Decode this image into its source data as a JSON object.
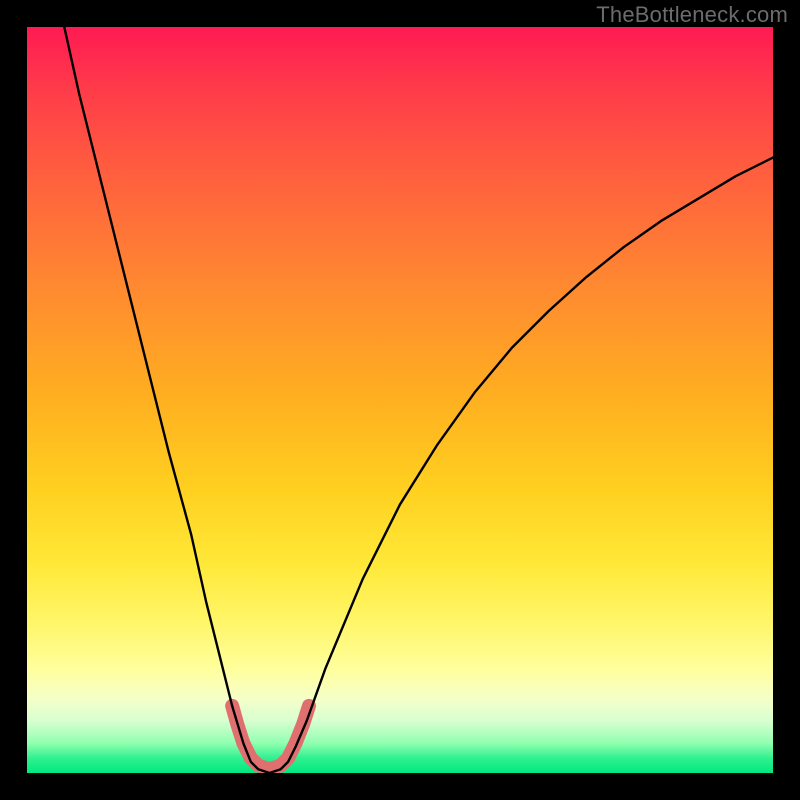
{
  "watermark": "TheBottleneck.com",
  "chart_data": {
    "type": "line",
    "title": "",
    "xlabel": "",
    "ylabel": "",
    "xlim": [
      0,
      100
    ],
    "ylim": [
      0,
      100
    ],
    "curve": [
      {
        "x": 5.0,
        "y": 100.0
      },
      {
        "x": 7.0,
        "y": 91.0
      },
      {
        "x": 10.0,
        "y": 79.0
      },
      {
        "x": 13.0,
        "y": 67.0
      },
      {
        "x": 16.0,
        "y": 55.0
      },
      {
        "x": 19.0,
        "y": 43.0
      },
      {
        "x": 22.0,
        "y": 32.0
      },
      {
        "x": 24.0,
        "y": 23.0
      },
      {
        "x": 26.0,
        "y": 15.0
      },
      {
        "x": 27.5,
        "y": 9.0
      },
      {
        "x": 29.0,
        "y": 4.0
      },
      {
        "x": 30.0,
        "y": 1.5
      },
      {
        "x": 31.0,
        "y": 0.5
      },
      {
        "x": 32.5,
        "y": 0.0
      },
      {
        "x": 34.0,
        "y": 0.5
      },
      {
        "x": 35.0,
        "y": 1.5
      },
      {
        "x": 36.0,
        "y": 3.5
      },
      {
        "x": 37.5,
        "y": 7.0
      },
      {
        "x": 40.0,
        "y": 14.0
      },
      {
        "x": 45.0,
        "y": 26.0
      },
      {
        "x": 50.0,
        "y": 36.0
      },
      {
        "x": 55.0,
        "y": 44.0
      },
      {
        "x": 60.0,
        "y": 51.0
      },
      {
        "x": 65.0,
        "y": 57.0
      },
      {
        "x": 70.0,
        "y": 62.0
      },
      {
        "x": 75.0,
        "y": 66.5
      },
      {
        "x": 80.0,
        "y": 70.5
      },
      {
        "x": 85.0,
        "y": 74.0
      },
      {
        "x": 90.0,
        "y": 77.0
      },
      {
        "x": 95.0,
        "y": 80.0
      },
      {
        "x": 100.0,
        "y": 82.5
      }
    ],
    "markers": [
      {
        "x": 27.5,
        "y": 9.0
      },
      {
        "x": 28.2,
        "y": 6.5
      },
      {
        "x": 29.0,
        "y": 4.0
      },
      {
        "x": 30.0,
        "y": 2.0
      },
      {
        "x": 31.0,
        "y": 1.0
      },
      {
        "x": 32.5,
        "y": 0.5
      },
      {
        "x": 34.0,
        "y": 1.0
      },
      {
        "x": 35.0,
        "y": 2.0
      },
      {
        "x": 36.0,
        "y": 4.0
      },
      {
        "x": 37.0,
        "y": 6.5
      },
      {
        "x": 37.8,
        "y": 9.0
      }
    ],
    "colors": {
      "curve": "#000000",
      "marker": "#e07070",
      "marker_width": 14
    }
  }
}
